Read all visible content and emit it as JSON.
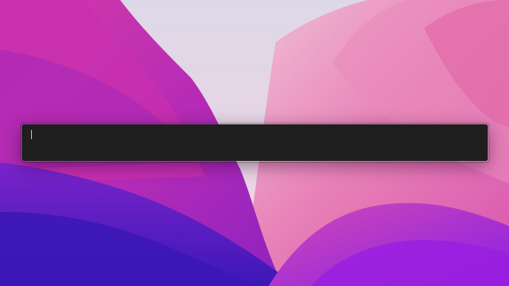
{
  "desktop": {
    "wallpaper_icon": "monterey-wallpaper",
    "colors": {
      "sky": "#e2dbe6",
      "haze": "#f0c6da",
      "pink": "#e263ab",
      "magenta": "#c42bb8",
      "violet": "#8a22c9",
      "deep_blue": "#4a1bc4",
      "bright_violet": "#9b1fe0"
    }
  },
  "command_bar": {
    "value": "",
    "placeholder": "",
    "background": "#1e1e1e",
    "cursor_color": "#d9d9d9"
  }
}
